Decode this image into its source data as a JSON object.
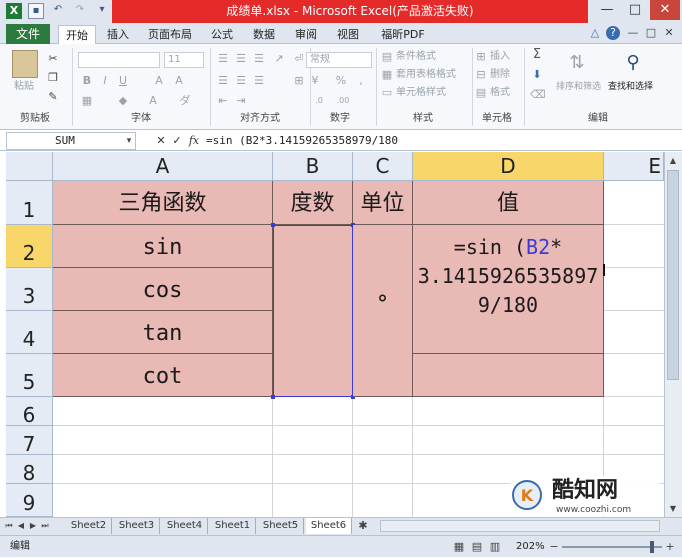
{
  "window": {
    "title": "成绩单.xlsx - Microsoft Excel(产品激活失败)",
    "controls": [
      "—",
      "□",
      "✕"
    ]
  },
  "ribbon": {
    "tabs": [
      {
        "label": "文件"
      },
      {
        "label": "开始"
      },
      {
        "label": "插入"
      },
      {
        "label": "页面布局"
      },
      {
        "label": "公式"
      },
      {
        "label": "数据"
      },
      {
        "label": "审阅"
      },
      {
        "label": "视图"
      },
      {
        "label": "福昕PDF"
      }
    ],
    "paste_label": "粘贴",
    "font_size": "11",
    "number_format": "常规",
    "conditional_format": "条件格式",
    "table_format": "套用表格格式",
    "cell_style": "单元格样式",
    "insert": "插入",
    "delete": "删除",
    "format": "格式",
    "sort_filter": "排序和筛选",
    "find_select": "查找和选择",
    "groups": [
      "剪贴板",
      "字体",
      "对齐方式",
      "数字",
      "样式",
      "单元格",
      "编辑"
    ]
  },
  "formula_bar": {
    "name_box": "SUM",
    "fx": "fx",
    "formula": "=sin (B2*3.14159265358979/180"
  },
  "sheet": {
    "columns": [
      "A",
      "B",
      "C",
      "D",
      "E"
    ],
    "rows": [
      "1",
      "2",
      "3",
      "4",
      "5",
      "6",
      "7",
      "8",
      "9"
    ],
    "header": {
      "a": "三角函数",
      "b": "度数",
      "c": "单位",
      "d": "值"
    },
    "functions": [
      "sin",
      "cos",
      "tan",
      "cot"
    ],
    "unit": "°",
    "editing": {
      "prefix": "=sin (",
      "ref": "B2",
      "op": "*",
      "line2": "3.1415926535897",
      "line3": "9/180"
    },
    "colors": {
      "fill": "#e8b9b5",
      "ref_blue": "#3a3ad6",
      "selected_header": "#f8d66a"
    }
  },
  "sheet_tabs": [
    "Sheet2",
    "Sheet3",
    "Sheet4",
    "Sheet1",
    "Sheet5",
    "Sheet6"
  ],
  "status": {
    "mode": "编辑",
    "zoom": "202%"
  },
  "watermark": {
    "brand": "酷知网",
    "url": "www.coozhi.com"
  }
}
